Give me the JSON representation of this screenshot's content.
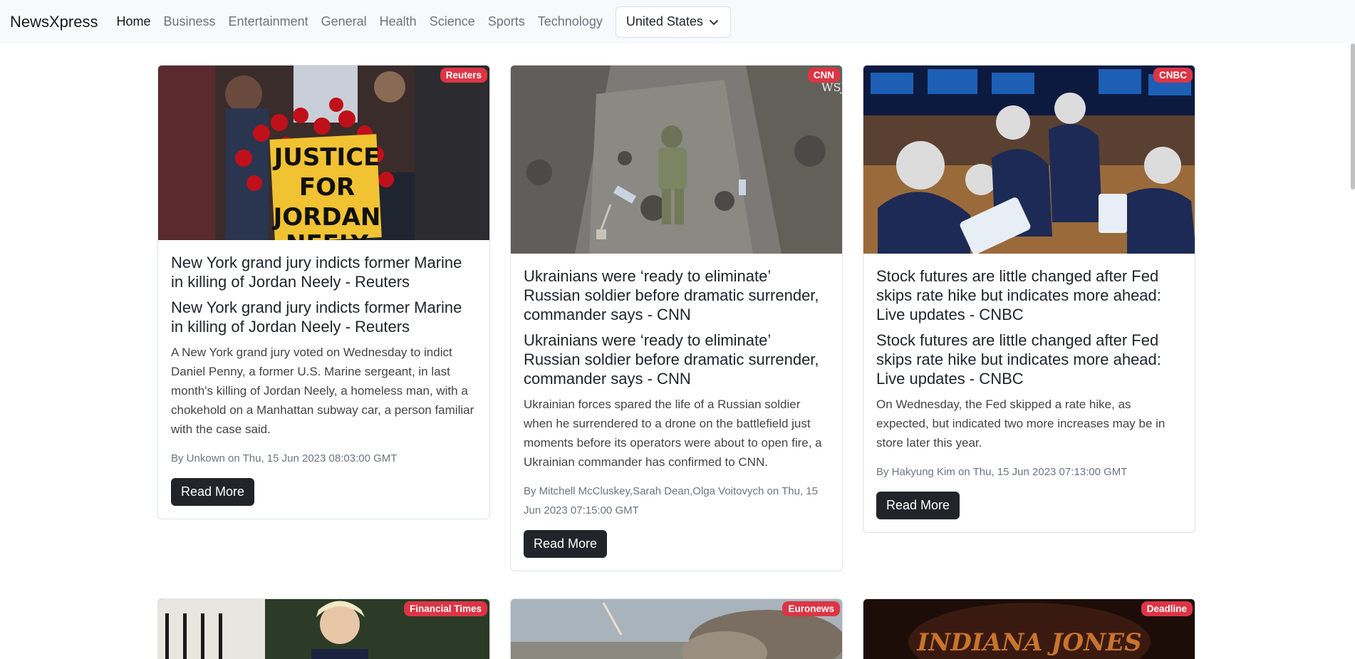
{
  "nav": {
    "brand": "NewsXpress",
    "links": [
      "Home",
      "Business",
      "Entertainment",
      "General",
      "Health",
      "Science",
      "Sports",
      "Technology"
    ],
    "active": "Home",
    "country": "United States"
  },
  "articles": [
    {
      "source": "Reuters",
      "title": "New York grand jury indicts former Marine in killing of Jordan Neely - Reuters",
      "subtitle": "New York grand jury indicts former Marine in killing of Jordan Neely - Reuters",
      "description": "A New York grand jury voted on Wednesday to indict Daniel Penny, a former U.S. Marine sergeant, in last month's killing of Jordan Neely, a homeless man, with a chokehold on a Manhattan subway car, a person familiar with the case said.",
      "meta": "By Unkown on Thu, 15 Jun 2023 08:03:00 GMT",
      "button": "Read More",
      "image_sign_text": [
        "JUSTICE",
        "FOR",
        "JORDAN",
        "NEELY"
      ]
    },
    {
      "source": "CNN",
      "title": "Ukrainians were ‘ready to eliminate’ Russian soldier before dramatic surrender, commander says - CNN",
      "subtitle": "Ukrainians were ‘ready to eliminate’ Russian soldier before dramatic surrender, commander says - CNN",
      "description": "Ukrainian forces spared the life of a Russian soldier when he surrendered to a drone on the battlefield just moments before its operators were about to open fire, a Ukrainian commander has confirmed to CNN.",
      "meta": "By Mitchell McCluskey,Sarah Dean,Olga Voitovych on Thu, 15 Jun 2023 07:15:00 GMT",
      "button": "Read More",
      "image_watermark": "WSJ"
    },
    {
      "source": "CNBC",
      "title": "Stock futures are little changed after Fed skips rate hike but indicates more ahead: Live updates - CNBC",
      "subtitle": "Stock futures are little changed after Fed skips rate hike but indicates more ahead: Live updates - CNBC",
      "description": "On Wednesday, the Fed skipped a rate hike, as expected, but indicated two more increases may be in store later this year.",
      "meta": "By Hakyung Kim on Thu, 15 Jun 2023 07:13:00 GMT",
      "button": "Read More"
    },
    {
      "source": "Financial Times"
    },
    {
      "source": "Euronews"
    },
    {
      "source": "Deadline",
      "image_title_text": "INDIANA JONES"
    }
  ],
  "colors": {
    "badge": "#dc3545",
    "button": "#212529",
    "navbar": "#f8f9fa"
  }
}
